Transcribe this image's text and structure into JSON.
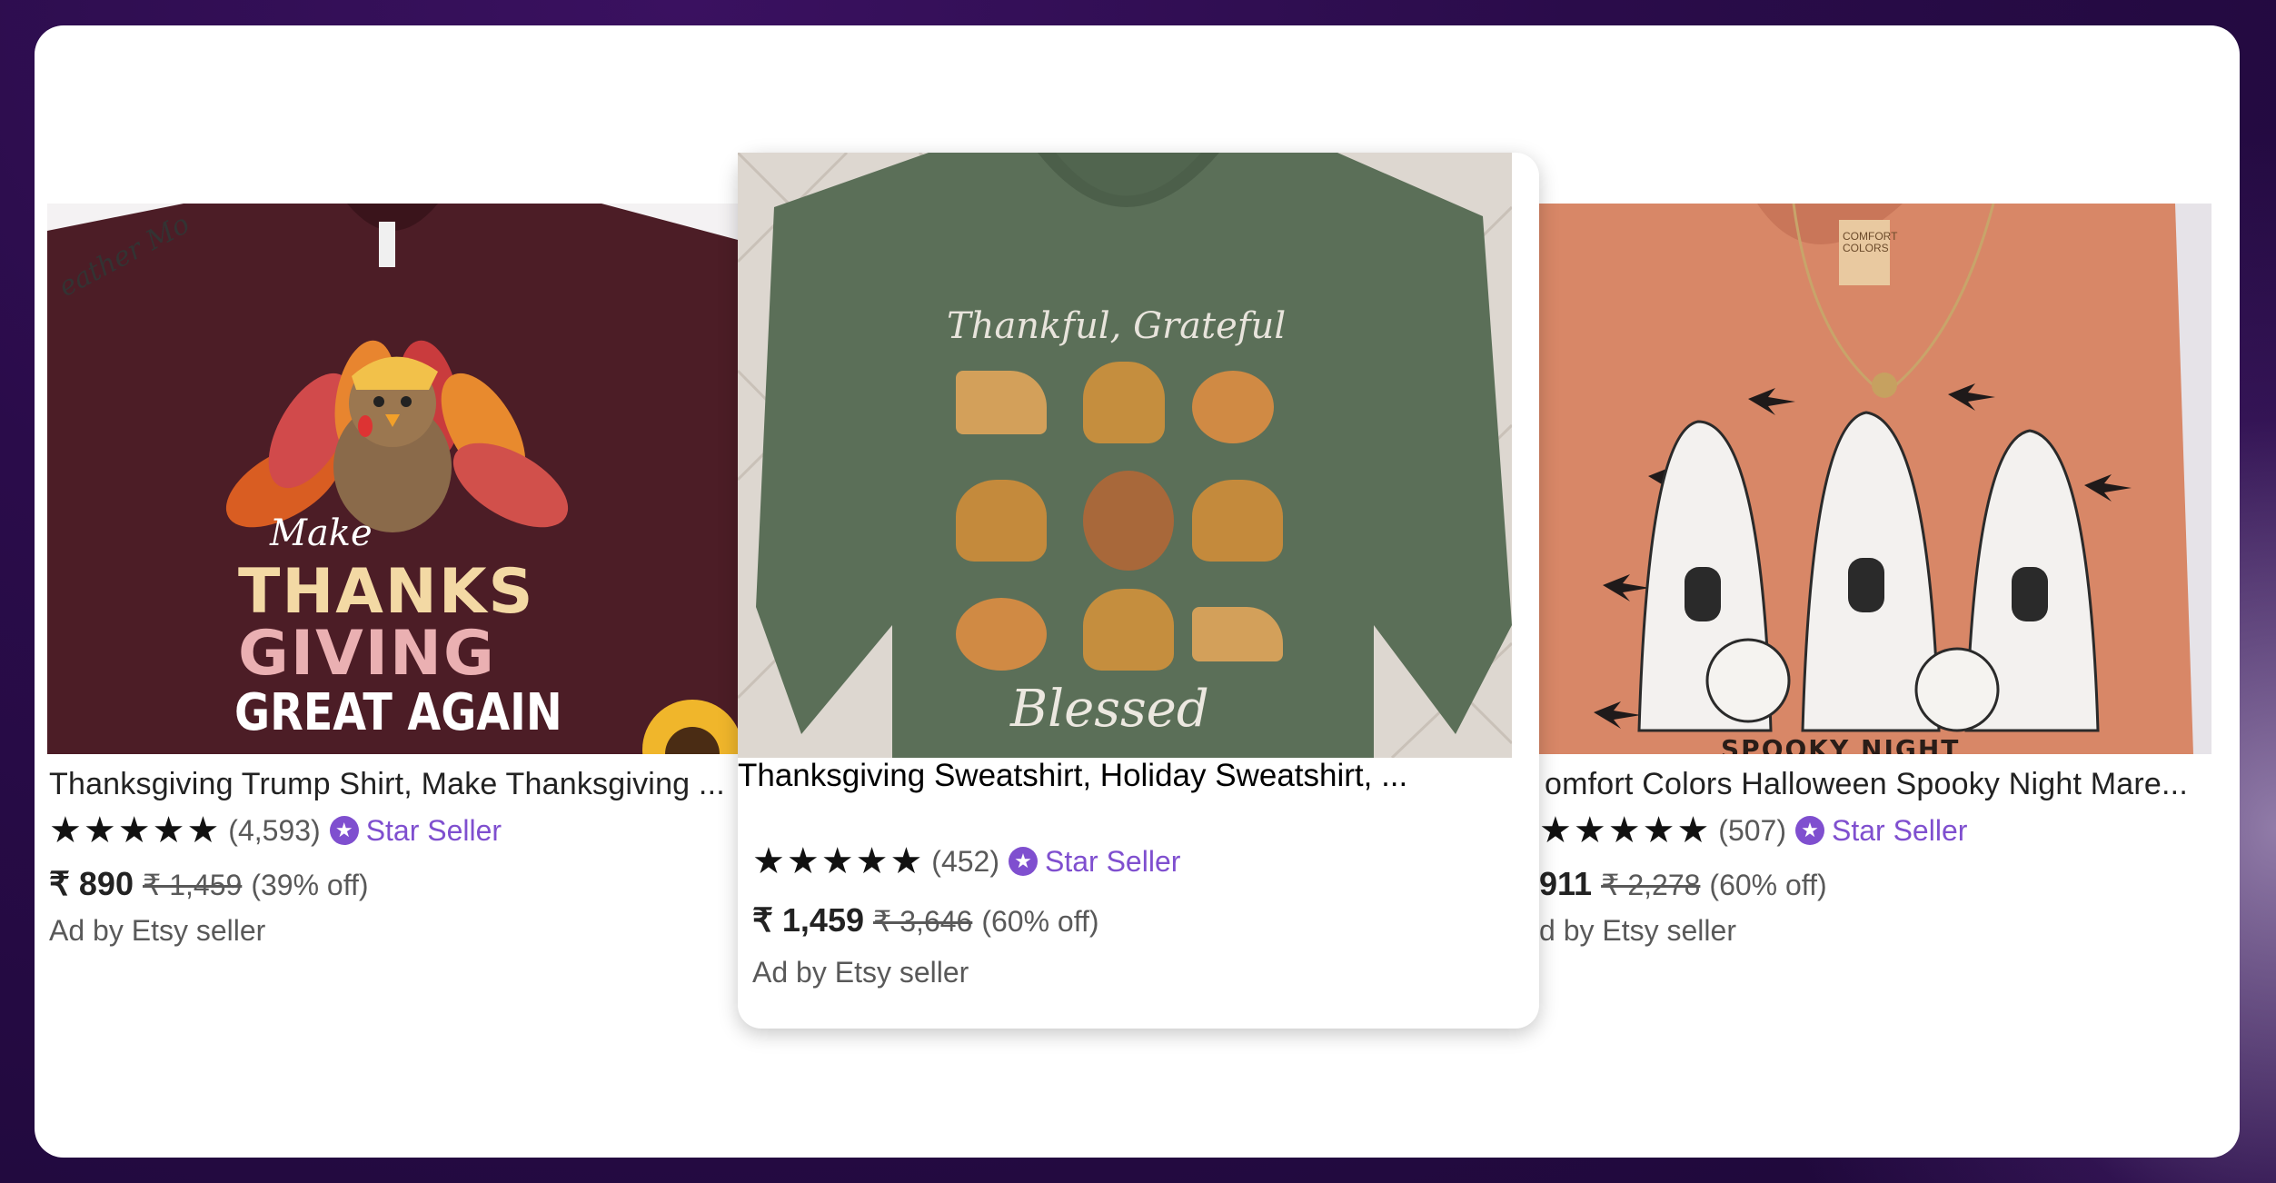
{
  "products": [
    {
      "title": "Thanksgiving Trump Shirt, Make Thanksgiving ...",
      "rating_stars": 5,
      "review_count": "(4,593)",
      "badge": "Star Seller",
      "price": "₹ 890",
      "original_price": "₹ 1,459",
      "discount": "(39% off)",
      "ad_label": "Ad by Etsy seller",
      "image": {
        "bg": "#3f1a21",
        "tee": "#52202a",
        "text_lines": [
          "Make",
          "THANKS",
          "GIVING",
          "GREAT AGAIN"
        ],
        "corner_text": "eather Mo"
      }
    },
    {
      "title": "Thanksgiving Sweatshirt, Holiday Sweatshirt, ...",
      "rating_stars": 5,
      "review_count": "(452)",
      "badge": "Star Seller",
      "price": "₹ 1,459",
      "original_price": "₹ 3,646",
      "discount": "(60% off)",
      "ad_label": "Ad by Etsy seller",
      "image": {
        "bg": "#d9d3cc",
        "tee": "#5b6f58",
        "top_text": "Thankful, Grateful",
        "bottom_text": "Blessed"
      }
    },
    {
      "title": "omfort Colors Halloween Spooky Night Mare...",
      "rating_stars": 5,
      "review_count": "(507)",
      "badge": "Star Seller",
      "price": "911",
      "original_price": "₹ 2,278",
      "discount": "(60% off)",
      "ad_label": "d by Etsy seller",
      "image": {
        "bg": "#e4e1e6",
        "tee": "#d98a6a",
        "tag_text": "COMFORT COLORS",
        "bottom_text": "SPOOKY NIGHT"
      }
    }
  ],
  "colors": {
    "accent": "#7f4fcf",
    "frame": "#ffffff"
  }
}
